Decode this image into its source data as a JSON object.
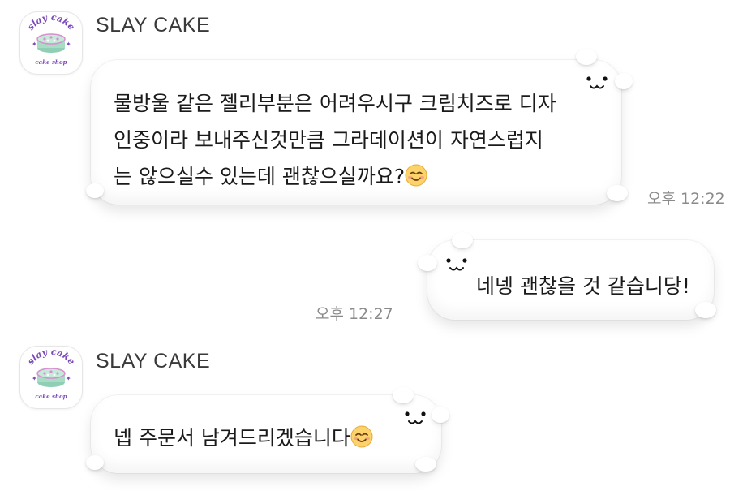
{
  "chat": {
    "messages": [
      {
        "sender": "SLAY CAKE",
        "avatar": {
          "top": "slay cake",
          "bottom": "cake shop"
        },
        "lines": [
          "물방울 같은 젤리부분은 어려우시구 크림치즈로 디자",
          "인중이라 보내주신것만큼 그라데이션이 자연스럽지",
          "는 않으실수 있는데 괜찮으실까요?"
        ],
        "time": "오후 12:22"
      },
      {
        "text": "네넹 괜찮을 것 같습니당!",
        "time": "오후 12:27"
      },
      {
        "sender": "SLAY CAKE",
        "avatar": {
          "top": "slay cake",
          "bottom": "cake shop"
        },
        "text": "넵 주문서 남겨드리겠습니다"
      }
    ]
  },
  "icons": {
    "emoji": "smiling-face-emoji",
    "face": "cat-face-icon",
    "avatar": "cake-logo-icon"
  },
  "colors": {
    "background": "#ffffff",
    "bubble": "#ffffff",
    "time": "#8a8a8a",
    "cake_mint": "#9fd8bf",
    "cake_pink": "#d98fcf",
    "cake_purple": "#7b4ab8"
  }
}
